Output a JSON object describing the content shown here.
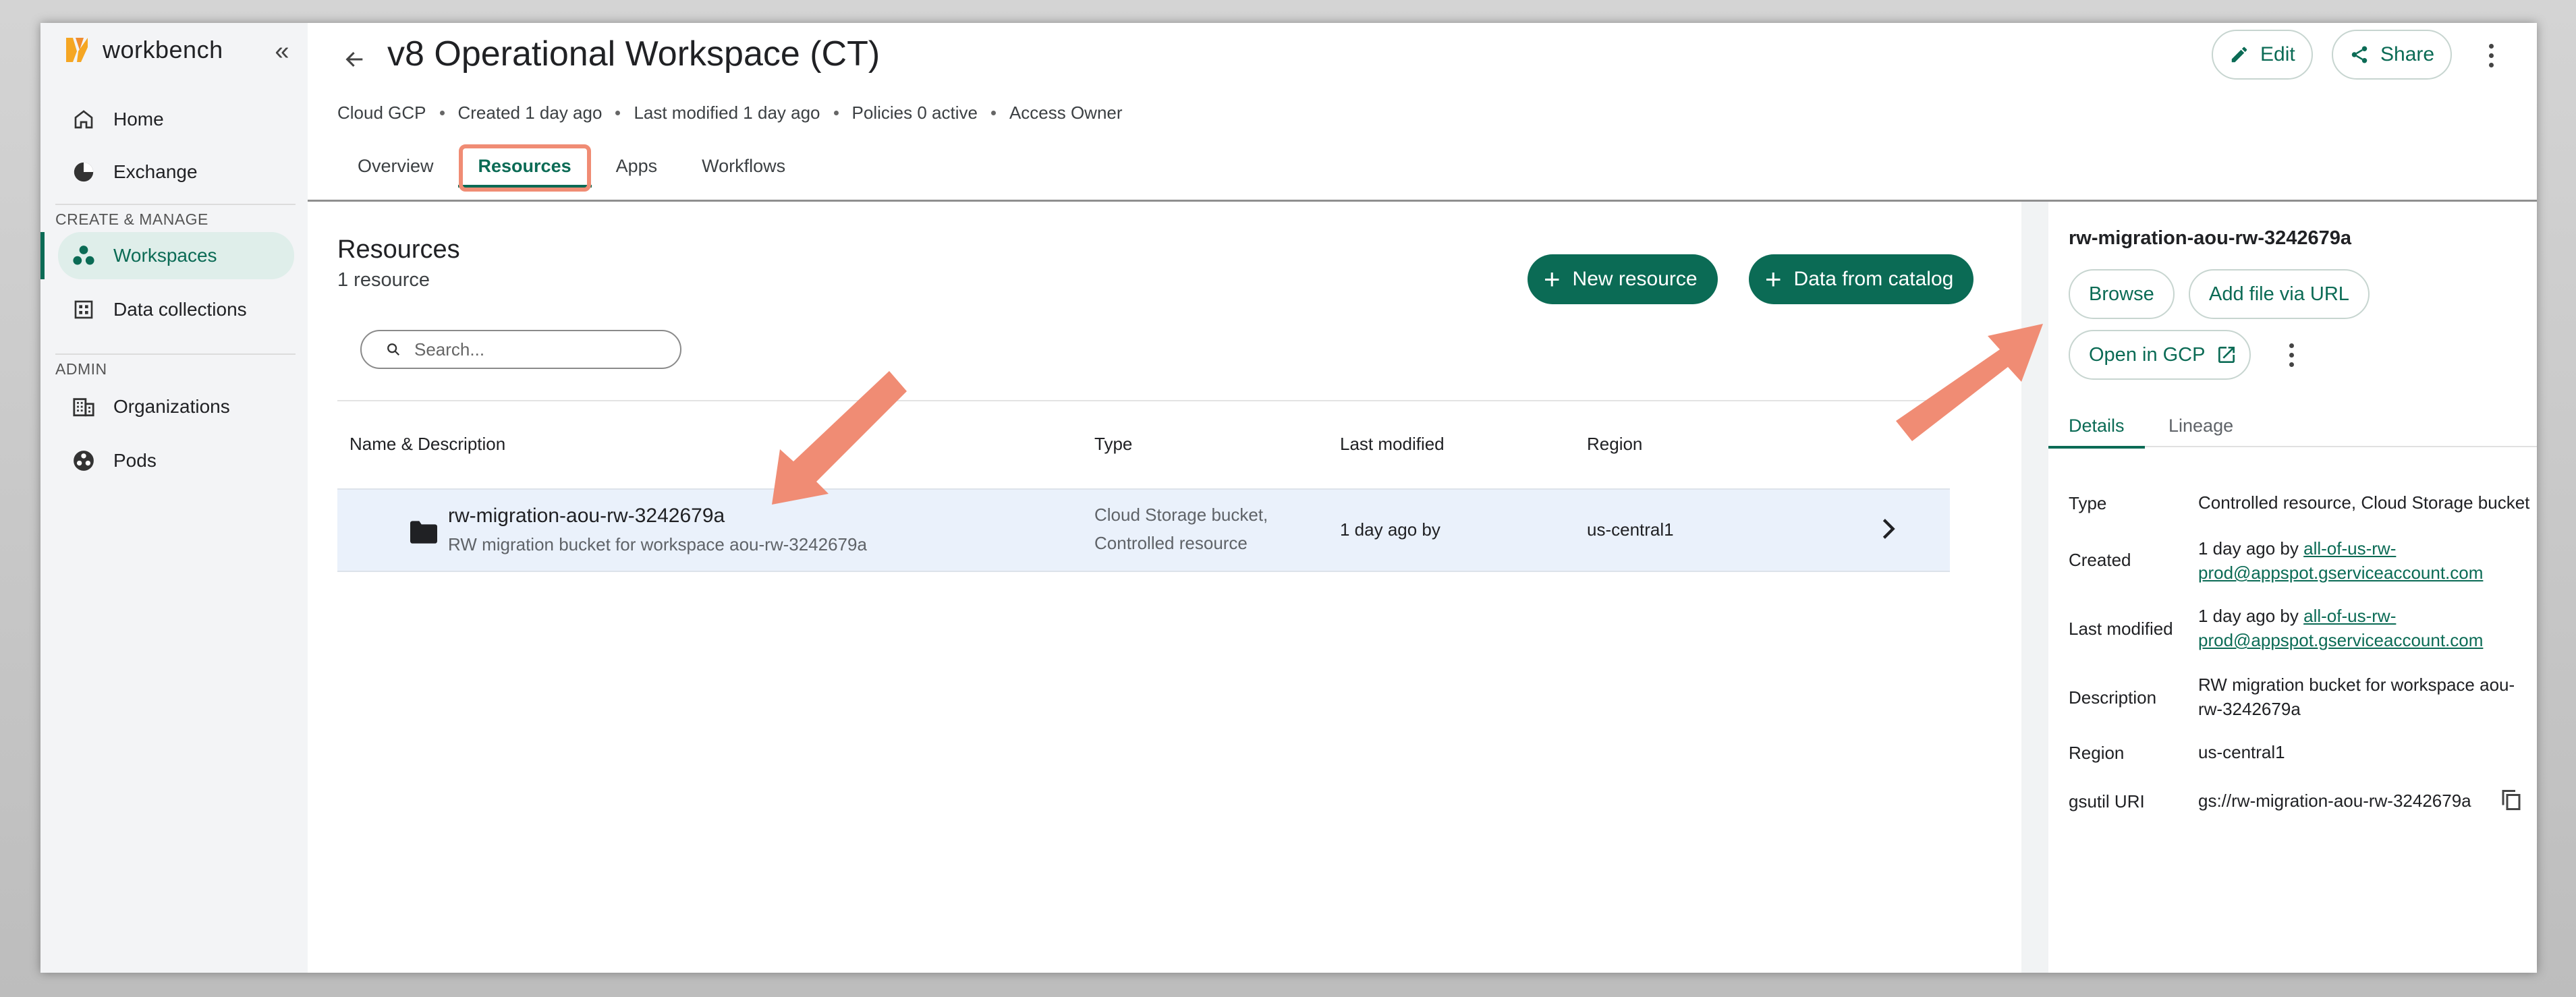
{
  "sidebar": {
    "brand": "workbench",
    "nav": [
      {
        "label": "Home",
        "icon": "home-icon"
      },
      {
        "label": "Exchange",
        "icon": "exchange-icon"
      }
    ],
    "section_create": "CREATE & MANAGE",
    "nav_create": [
      {
        "label": "Workspaces",
        "icon": "workspaces-icon",
        "active": true
      },
      {
        "label": "Data collections",
        "icon": "data-collections-icon"
      }
    ],
    "section_admin": "ADMIN",
    "nav_admin": [
      {
        "label": "Organizations",
        "icon": "organizations-icon"
      },
      {
        "label": "Pods",
        "icon": "pods-icon"
      }
    ]
  },
  "header": {
    "title": "v8 Operational Workspace (CT)",
    "meta": [
      "Cloud GCP",
      "Created 1 day ago",
      "Last modified 1 day ago",
      "Policies 0 active",
      "Access Owner"
    ],
    "edit_label": "Edit",
    "share_label": "Share"
  },
  "tabs": [
    "Overview",
    "Resources",
    "Apps",
    "Workflows"
  ],
  "resources": {
    "title": "Resources",
    "count": "1 resource",
    "new_resource_label": "New resource",
    "data_from_catalog_label": "Data from catalog",
    "search_placeholder": "Search...",
    "columns": [
      "Name & Description",
      "Type",
      "Last modified",
      "Region"
    ],
    "rows": [
      {
        "name": "rw-migration-aou-rw-3242679a",
        "description": "RW migration bucket for workspace aou-rw-3242679a",
        "type_line1": "Cloud Storage bucket,",
        "type_line2": "Controlled resource",
        "last_modified": "1 day ago by",
        "region": "us-central1"
      }
    ]
  },
  "panel": {
    "title": "rw-migration-aou-rw-3242679a",
    "browse_label": "Browse",
    "add_file_label": "Add file via URL",
    "open_gcp_label": "Open in GCP",
    "tabs": [
      "Details",
      "Lineage"
    ],
    "details": {
      "type_label": "Type",
      "type_value": "Controlled resource, Cloud Storage bucket",
      "created_label": "Created",
      "created_prefix": "1 day ago by ",
      "created_link": "all-of-us-rw-prod@appspot.gserviceaccount.com",
      "modified_label": "Last modified",
      "modified_prefix": "1 day ago by ",
      "modified_link": "all-of-us-rw-prod@appspot.gserviceaccount.com",
      "description_label": "Description",
      "description_value": "RW migration bucket for workspace aou-rw-3242679a",
      "region_label": "Region",
      "region_value": "us-central1",
      "gsutil_label": "gsutil URI",
      "gsutil_value": "gs://rw-migration-aou-rw-3242679a"
    }
  },
  "colors": {
    "accent": "#0b6b55",
    "active_nav_bg": "#dfeeea",
    "annotation": "#f08c74",
    "row_highlight": "#eaf1fb"
  }
}
